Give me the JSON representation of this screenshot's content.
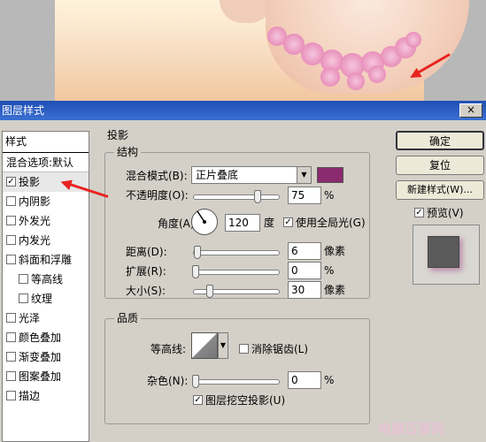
{
  "window": {
    "title": "图层样式",
    "close_label": "×"
  },
  "style_list": {
    "header": "样式",
    "blend_options": "混合选项:默认",
    "items": [
      {
        "label": "投影",
        "checked": true,
        "sub": false
      },
      {
        "label": "内阴影",
        "checked": false,
        "sub": false
      },
      {
        "label": "外发光",
        "checked": false,
        "sub": false
      },
      {
        "label": "内发光",
        "checked": false,
        "sub": false
      },
      {
        "label": "斜面和浮雕",
        "checked": false,
        "sub": false
      },
      {
        "label": "等高线",
        "checked": false,
        "sub": true
      },
      {
        "label": "纹理",
        "checked": false,
        "sub": true
      },
      {
        "label": "光泽",
        "checked": false,
        "sub": false
      },
      {
        "label": "颜色叠加",
        "checked": false,
        "sub": false
      },
      {
        "label": "渐变叠加",
        "checked": false,
        "sub": false
      },
      {
        "label": "图案叠加",
        "checked": false,
        "sub": false
      },
      {
        "label": "描边",
        "checked": false,
        "sub": false
      }
    ]
  },
  "panel": {
    "title": "投影",
    "structure": {
      "title": "结构",
      "blend_mode_label": "混合模式(B):",
      "blend_mode_value": "正片叠底",
      "shadow_color": "#8b2a6f",
      "opacity_label": "不透明度(O):",
      "opacity_value": "75",
      "opacity_unit": "%",
      "angle_label": "角度(A):",
      "angle_value": "120",
      "angle_unit": "度",
      "global_light_label": "使用全局光(G)",
      "distance_label": "距离(D):",
      "distance_value": "6",
      "distance_unit": "像素",
      "spread_label": "扩展(R):",
      "spread_value": "0",
      "spread_unit": "%",
      "size_label": "大小(S):",
      "size_value": "30",
      "size_unit": "像素"
    },
    "quality": {
      "title": "品质",
      "contour_label": "等高线:",
      "antialias_label": "消除锯齿(L)",
      "noise_label": "杂色(N):",
      "noise_value": "0",
      "noise_unit": "%",
      "knockout_label": "图层挖空投影(U)"
    }
  },
  "buttons": {
    "ok": "确定",
    "reset": "复位",
    "new_style": "新建样式(W)...",
    "preview_label": "预览(V)"
  },
  "watermark": "电脑百事网",
  "colors": {
    "annotation_arrow": "#e8231f",
    "titlebar": "#1f4fb5"
  }
}
